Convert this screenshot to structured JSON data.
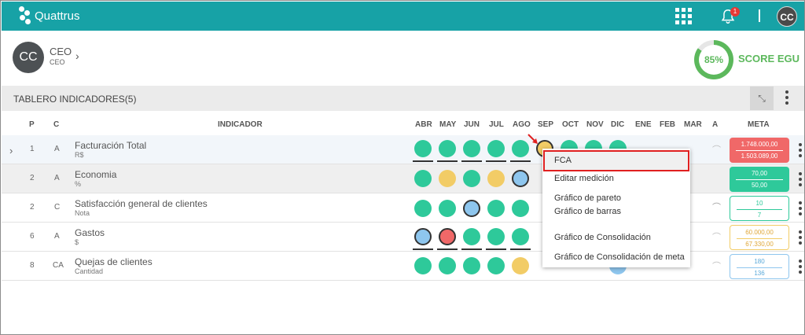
{
  "app": {
    "brand": "Quattrus",
    "notification_count": "1",
    "user_initials": "CC"
  },
  "profile": {
    "initials": "CC",
    "name": "CEO",
    "role": "CEO"
  },
  "score": {
    "value": "85%",
    "percent": 85,
    "label": "SCORE EGU"
  },
  "board": {
    "title": "TABLERO INDICADORES(5)"
  },
  "columns": {
    "p": "P",
    "c": "C",
    "indicador": "INDICADOR",
    "months": [
      "ABR",
      "MAY",
      "JUN",
      "JUL",
      "AGO",
      "SEP",
      "OCT",
      "NOV",
      "DIC",
      "ENE",
      "FEB",
      "MAR"
    ],
    "a": "A",
    "meta": "META"
  },
  "rows": [
    {
      "expand": "›",
      "p": "1",
      "c": "A",
      "name": "Facturación Total",
      "unit": "R$",
      "meta_top": "1.748.000,00",
      "meta_bottom": "1.503.089,00",
      "meta_color": "#f06868"
    },
    {
      "p": "2",
      "c": "A",
      "name": "Economia",
      "unit": "%",
      "meta_top": "70,00",
      "meta_bottom": "50,00",
      "meta_color": "#2ec99a"
    },
    {
      "p": "2",
      "c": "C",
      "name": "Satisfacción general de clientes",
      "unit": "Nota",
      "meta_top": "10",
      "meta_bottom": "7",
      "meta_color": "#2ec99a"
    },
    {
      "p": "6",
      "c": "A",
      "name": "Gastos",
      "unit": "$",
      "meta_top": "60.000,00",
      "meta_bottom": "67.330,00",
      "meta_color": "#f2cc66"
    },
    {
      "p": "8",
      "c": "CA",
      "name": "Quejas de clientes",
      "unit": "Cantidad",
      "meta_top": "180",
      "meta_bottom": "136",
      "meta_color": "#8ec6ee"
    }
  ],
  "menu": {
    "items": [
      "FCA",
      "Editar medición",
      "Gráfico de pareto",
      "Gráfico de barras",
      "Gráfico de Consolidación",
      "Gráfico de Consolidación de meta"
    ]
  },
  "colors": {
    "header": "#17a2a6",
    "green": "#2ec99a",
    "yellow": "#f2cc66",
    "red": "#f06868",
    "blue": "#8ec6ee",
    "highlight": "#e02020"
  }
}
